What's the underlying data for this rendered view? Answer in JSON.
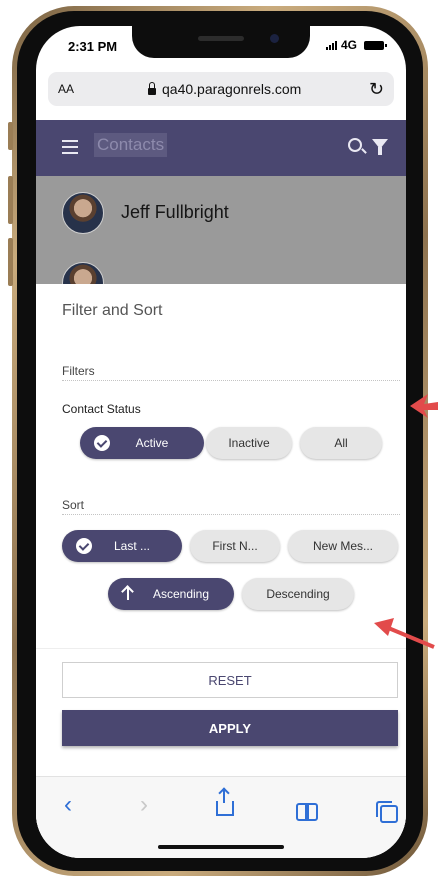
{
  "status_bar": {
    "time": "2:31 PM",
    "network": "4G"
  },
  "browser": {
    "text_size_label": "AA",
    "url": "qa40.paragonrels.com"
  },
  "header": {
    "title": "Contacts"
  },
  "contacts": [
    {
      "name": "Jeff Fullbright"
    }
  ],
  "sheet": {
    "title": "Filter and Sort",
    "filters_label": "Filters",
    "contact_status_label": "Contact Status",
    "status_options": [
      {
        "label": "Active",
        "selected": true
      },
      {
        "label": "Inactive",
        "selected": false
      },
      {
        "label": "All",
        "selected": false
      }
    ],
    "sort_label": "Sort",
    "sort_options": [
      {
        "label": "Last ...",
        "selected": true
      },
      {
        "label": "First N...",
        "selected": false
      },
      {
        "label": "New Mes...",
        "selected": false
      }
    ],
    "order_options": [
      {
        "label": "Ascending",
        "selected": true
      },
      {
        "label": "Descending",
        "selected": false
      }
    ],
    "reset_label": "RESET",
    "apply_label": "APPLY"
  },
  "colors": {
    "accent": "#4a4770",
    "chip_unselected": "#e6e6e6",
    "annotation_arrow": "#e24b4b",
    "toolbar_icon": "#2f6fd6"
  },
  "toolbar_icons": [
    "back-icon",
    "forward-icon",
    "share-icon",
    "bookmarks-icon",
    "tabs-icon"
  ]
}
